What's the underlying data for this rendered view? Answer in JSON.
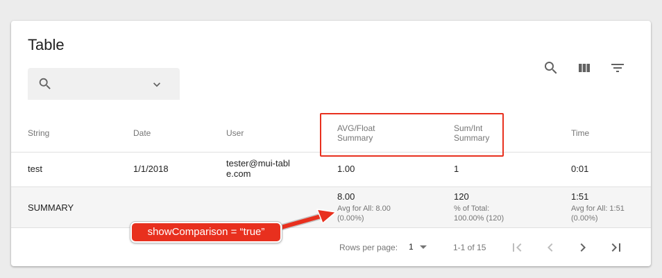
{
  "title": "Table",
  "toolbar": {
    "search_icon": "search-icon",
    "columns_icon": "view-column-icon",
    "filter_icon": "filter-list-icon"
  },
  "search": {
    "value": "",
    "dropdown_icon": "chevron-down-icon"
  },
  "columns": [
    "String",
    "Date",
    "User",
    "AVG/Float Summary",
    "Sum/Int Summary",
    "Time"
  ],
  "rows": [
    {
      "string": "test",
      "date": "1/1/2018",
      "user": "tester@mui-table.com",
      "float": "1.00",
      "int": "1",
      "time": "0:01"
    }
  ],
  "summary": {
    "label": "SUMMARY",
    "float": {
      "value": "8.00",
      "comparison": "Avg for All: 8.00",
      "percent": "(0.00%)"
    },
    "int": {
      "value": "120",
      "comparison": "% of Total:",
      "percent": "100.00% (120)"
    },
    "time": {
      "value": "1:51",
      "comparison": "Avg for All: 1:51",
      "percent": "(0.00%)"
    }
  },
  "pagination": {
    "rows_per_page_label": "Rows per page:",
    "rows_per_page": "1",
    "range": "1-1 of 15"
  },
  "annotation": {
    "callout": "showComparison = “true”",
    "color": "#e8301e"
  }
}
